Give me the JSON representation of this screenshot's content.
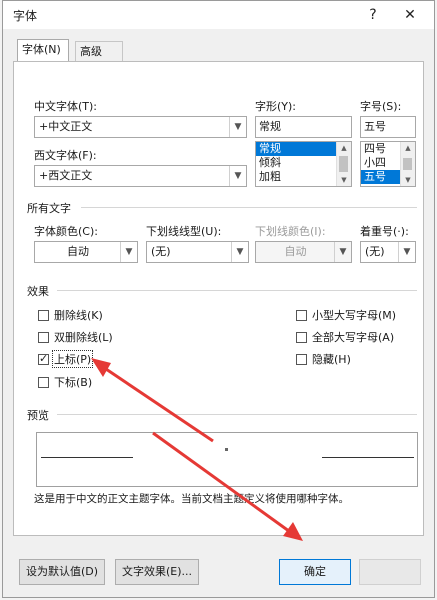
{
  "window": {
    "title": "字体",
    "help": "?",
    "close": "✕"
  },
  "tabs": [
    {
      "label": "字体(N)"
    },
    {
      "label": "高级(V)"
    }
  ],
  "chinese_font": {
    "label": "中文字体(T):",
    "value": "+中文正文"
  },
  "western_font": {
    "label": "西文字体(F):",
    "value": "+西文正文"
  },
  "font_style": {
    "label": "字形(Y):",
    "value": "常规",
    "options": [
      "常规",
      "倾斜",
      "加粗"
    ],
    "selected": "常规"
  },
  "font_size": {
    "label": "字号(S):",
    "value": "五号",
    "options": [
      "四号",
      "小四",
      "五号"
    ],
    "selected": "五号"
  },
  "all_text": {
    "heading": "所有文字",
    "font_color": {
      "label": "字体颜色(C):",
      "value": "自动"
    },
    "underline_type": {
      "label": "下划线线型(U):",
      "value": "(无)"
    },
    "underline_color": {
      "label": "下划线颜色(I):",
      "value": "自动"
    },
    "emphasis": {
      "label": "着重号(·):",
      "value": "(无)"
    }
  },
  "effects": {
    "heading": "效果",
    "left": [
      {
        "label": "删除线(K)",
        "checked": false
      },
      {
        "label": "双删除线(L)",
        "checked": false
      },
      {
        "label": "上标(P)",
        "checked": true
      },
      {
        "label": "下标(B)",
        "checked": false
      }
    ],
    "right": [
      {
        "label": "小型大写字母(M)",
        "checked": false
      },
      {
        "label": "全部大写字母(A)",
        "checked": false
      },
      {
        "label": "隐藏(H)",
        "checked": false
      }
    ]
  },
  "preview": {
    "heading": "预览",
    "description": "这是用于中文的正文主题字体。当前文档主题定义将使用哪种字体。"
  },
  "buttons": {
    "default": "设为默认值(D)",
    "text_effects": "文字效果(E)...",
    "ok": "确定"
  },
  "annotation_color": "#e53935",
  "accent_color": "#0078d7"
}
